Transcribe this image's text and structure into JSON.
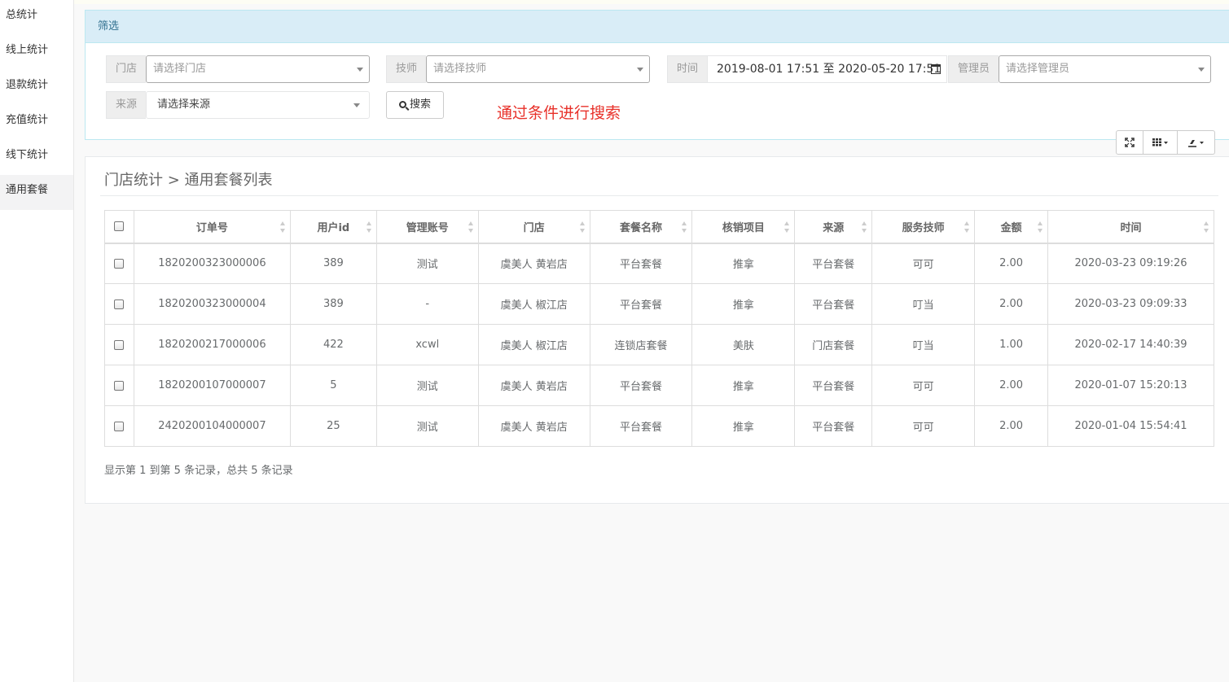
{
  "sidebar": {
    "items": [
      {
        "label": "总统计"
      },
      {
        "label": "线上统计"
      },
      {
        "label": "退款统计"
      },
      {
        "label": "充值统计"
      },
      {
        "label": "线下统计"
      },
      {
        "label": "通用套餐"
      }
    ]
  },
  "filter": {
    "title": "筛选",
    "store_label": "门店",
    "store_placeholder": "请选择门店",
    "tech_label": "技师",
    "tech_placeholder": "请选择技师",
    "time_label": "时间",
    "time_value": "2019-08-01 17:51 至 2020-05-20 17:51",
    "admin_label": "管理员",
    "admin_placeholder": "请选择管理员",
    "source_label": "来源",
    "source_value": "请选择来源",
    "search_label": "搜索",
    "hint": "通过条件进行搜索"
  },
  "breadcrumb": "门店统计 > 通用套餐列表",
  "table": {
    "headers": [
      "订单号",
      "用户id",
      "管理账号",
      "门店",
      "套餐名称",
      "核销项目",
      "来源",
      "服务技师",
      "金额",
      "时间"
    ],
    "rows": [
      [
        "1820200323000006",
        "389",
        "测试",
        "虞美人 黄岩店",
        "平台套餐",
        "推拿",
        "平台套餐",
        "可可",
        "2.00",
        "2020-03-23 09:19:26"
      ],
      [
        "1820200323000004",
        "389",
        "-",
        "虞美人 椒江店",
        "平台套餐",
        "推拿",
        "平台套餐",
        "叮当",
        "2.00",
        "2020-03-23 09:09:33"
      ],
      [
        "1820200217000006",
        "422",
        "xcwl",
        "虞美人 椒江店",
        "连锁店套餐",
        "美肤",
        "门店套餐",
        "叮当",
        "1.00",
        "2020-02-17 14:40:39"
      ],
      [
        "1820200107000007",
        "5",
        "测试",
        "虞美人 黄岩店",
        "平台套餐",
        "推拿",
        "平台套餐",
        "可可",
        "2.00",
        "2020-01-07 15:20:13"
      ],
      [
        "2420200104000007",
        "25",
        "测试",
        "虞美人 黄岩店",
        "平台套餐",
        "推拿",
        "平台套餐",
        "可可",
        "2.00",
        "2020-01-04 15:54:41"
      ]
    ]
  },
  "pagination": "显示第 1 到第 5 条记录，总共 5 条记录",
  "colors": {
    "accent_header_bg": "#d9edf7",
    "hint": "#e8312a"
  }
}
